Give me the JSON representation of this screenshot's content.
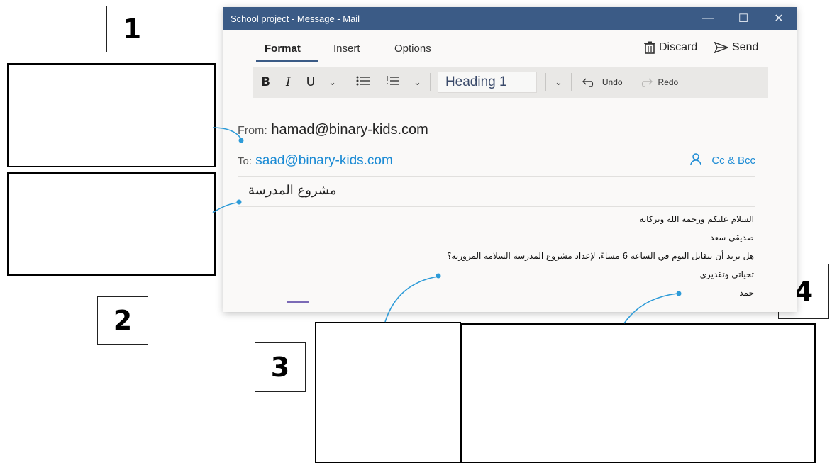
{
  "labels": {
    "one": "1",
    "two": "2",
    "three": "3",
    "four": "4"
  },
  "window": {
    "title": "School project - Message - Mail",
    "controls": {
      "minimize": "—",
      "maximize": "☐",
      "close": "✕"
    }
  },
  "menu": {
    "tabs": [
      "Format",
      "Insert",
      "Options"
    ],
    "discard": "Discard",
    "send": "Send"
  },
  "toolbar": {
    "bold": "B",
    "italic": "I",
    "underline": "U",
    "heading_value": "Heading 1",
    "undo": "Undo",
    "redo": "Redo"
  },
  "message": {
    "from_label": "From:",
    "from_value": "hamad@binary-kids.com",
    "to_label": "To:",
    "to_value": "saad@binary-kids.com",
    "cc_bcc": "Cc & Bcc",
    "subject": "مشروع المدرسة",
    "body_lines": [
      "السلام عليكم ورحمة الله وبركاته",
      "صديقي سعد",
      "هل تريد أن نتقابل اليوم في الساعة 6 مساءً، لإعداد مشروع المدرسة السلامة المرورية؟",
      "تحياتي وتقديري",
      "حمد"
    ]
  },
  "colors": {
    "titlebar": "#3b5b86",
    "accent": "#1a8ad4",
    "connector": "#2d9bd8"
  },
  "icons": [
    "trash-icon",
    "send-icon",
    "bullet-list-icon",
    "numbered-list-icon",
    "chevron-down-icon",
    "undo-icon",
    "redo-icon",
    "person-icon"
  ]
}
